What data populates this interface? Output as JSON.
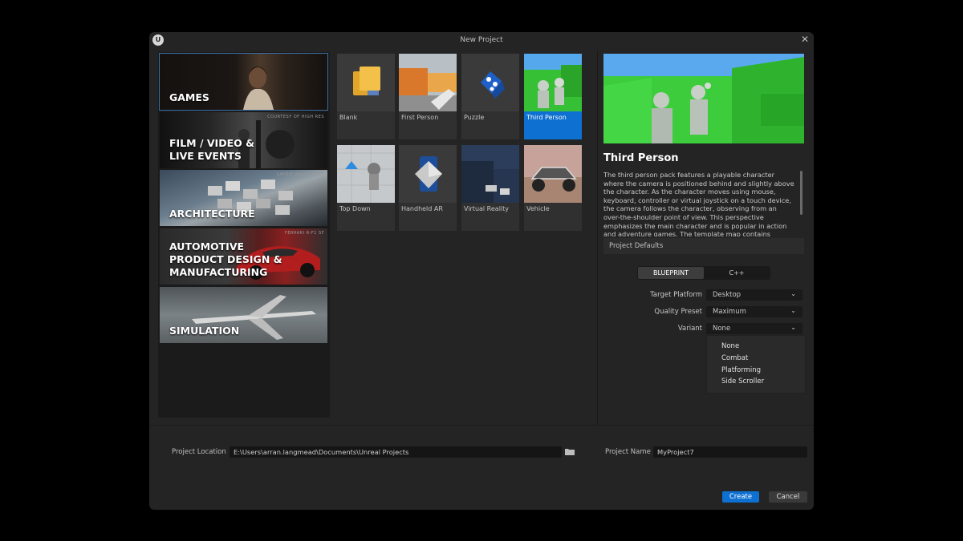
{
  "window": {
    "title": "New Project",
    "logo_icon": "unreal-logo-icon",
    "close_icon": "close-icon",
    "close_glyph": "✕",
    "logo_glyph": "U"
  },
  "categories": [
    {
      "label": "GAMES",
      "selected": true,
      "watermark": ""
    },
    {
      "label": "FILM / VIDEO &\nLIVE EVENTS",
      "selected": false,
      "watermark": "COURTESY OF HIGH RES"
    },
    {
      "label": "ARCHITECTURE",
      "selected": false,
      "watermark": "SAFDIE ARCHITECTS"
    },
    {
      "label": "AUTOMOTIVE\nPRODUCT DESIGN &\nMANUFACTURING",
      "selected": false,
      "watermark": "FERRARI R-F1 SF"
    },
    {
      "label": "SIMULATION",
      "selected": false,
      "watermark": ""
    }
  ],
  "templates": [
    {
      "name": "Blank",
      "selected": false
    },
    {
      "name": "First Person",
      "selected": false
    },
    {
      "name": "Puzzle",
      "selected": false
    },
    {
      "name": "Third Person",
      "selected": true
    },
    {
      "name": "Top Down",
      "selected": false
    },
    {
      "name": "Handheld AR",
      "selected": false
    },
    {
      "name": "Virtual Reality",
      "selected": false
    },
    {
      "name": "Vehicle",
      "selected": false
    }
  ],
  "details": {
    "title": "Third Person",
    "description": "The third person pack features a playable character where the camera is positioned behind and slightly above the character. As the character moves using mouse, keyboard, controller or virtual joystick on a touch device, the camera follows the character, observing from an over-the-shoulder point of view. This perspective emphasizes the main character and is popular in action and adventure games. The template map contains several objects that the player can",
    "defaults_header": "Project Defaults",
    "code_toggle": {
      "blueprint": "BLUEPRINT",
      "cpp": "C++",
      "selected": "BLUEPRINT"
    },
    "target_platform": {
      "label": "Target Platform",
      "value": "Desktop"
    },
    "quality_preset": {
      "label": "Quality Preset",
      "value": "Maximum"
    },
    "variant": {
      "label": "Variant",
      "value": "None",
      "options": [
        "None",
        "Combat",
        "Platforming",
        "Side Scroller"
      ]
    },
    "chevron_glyph": "⌄"
  },
  "footer": {
    "location_label": "Project Location",
    "location_value": "E:\\Users\\arran.langmead\\Documents\\Unreal Projects",
    "folder_icon": "folder-icon",
    "name_label": "Project Name",
    "name_value": "MyProject7",
    "create_label": "Create",
    "cancel_label": "Cancel"
  },
  "colors": {
    "accent": "#0e70d1",
    "dialog_bg": "#242424",
    "panel_bg": "#1b1b1b"
  }
}
